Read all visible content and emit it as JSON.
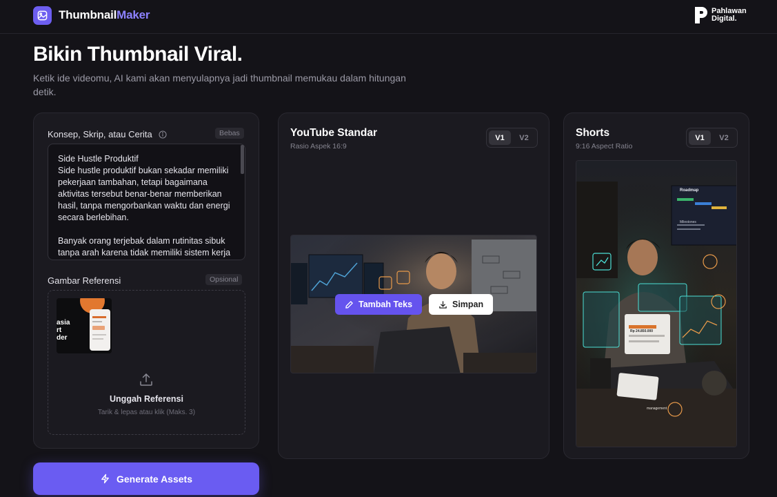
{
  "header": {
    "brand_part1": "Thumbnail",
    "brand_part2": "Maker",
    "partner_line1": "Pahlawan",
    "partner_line2": "Digital."
  },
  "hero": {
    "title": "Bikin Thumbnail Viral.",
    "subtitle": "Ketik ide videomu, AI kami akan menyulapnya jadi thumbnail memukau dalam hitungan detik."
  },
  "input_panel": {
    "concept_label": "Konsep, Skrip, atau Cerita",
    "concept_badge": "Bebas",
    "concept_text": "Side Hustle Produktif\nSide hustle produktif bukan sekadar memiliki pekerjaan tambahan, tetapi bagaimana aktivitas tersebut benar-benar memberikan hasil, tanpa mengorbankan waktu dan energi secara berlebihan.\n\nBanyak orang terjebak dalam rutinitas sibuk tanpa arah karena tidak memiliki sistem kerja",
    "ref_label": "Gambar Referensi",
    "ref_badge": "Opsional",
    "upload_title": "Unggah Referensi",
    "upload_hint": "Tarik & lepas atau klik (Maks. 3)",
    "ref_thumb_text": "asia\nrt\nder"
  },
  "generate_button": "Generate Assets",
  "youtube_card": {
    "title": "YouTube Standar",
    "subtitle": "Rasio Aspek 16:9",
    "version_1": "V1",
    "version_2": "V2",
    "edit_button": "Tambah Teks",
    "save_button": "Simpan"
  },
  "shorts_card": {
    "title": "Shorts",
    "subtitle": "9:16 Aspect Ratio",
    "version_1": "V1",
    "version_2": "V2",
    "screen_title": "Roadmap",
    "screen_milestones": "Milestones",
    "tablet_label": "Rp 24.850.000",
    "corner_caption": "management"
  },
  "colors": {
    "accent": "#6a5cf2",
    "brand_highlight": "#8d82ff",
    "background": "#141318",
    "card": "#1b1a20"
  },
  "icons": {
    "logo": "image-icon",
    "info": "info-icon",
    "upload": "upload-icon",
    "generate": "lightning-icon",
    "edit": "pencil-icon",
    "save": "download-icon"
  }
}
